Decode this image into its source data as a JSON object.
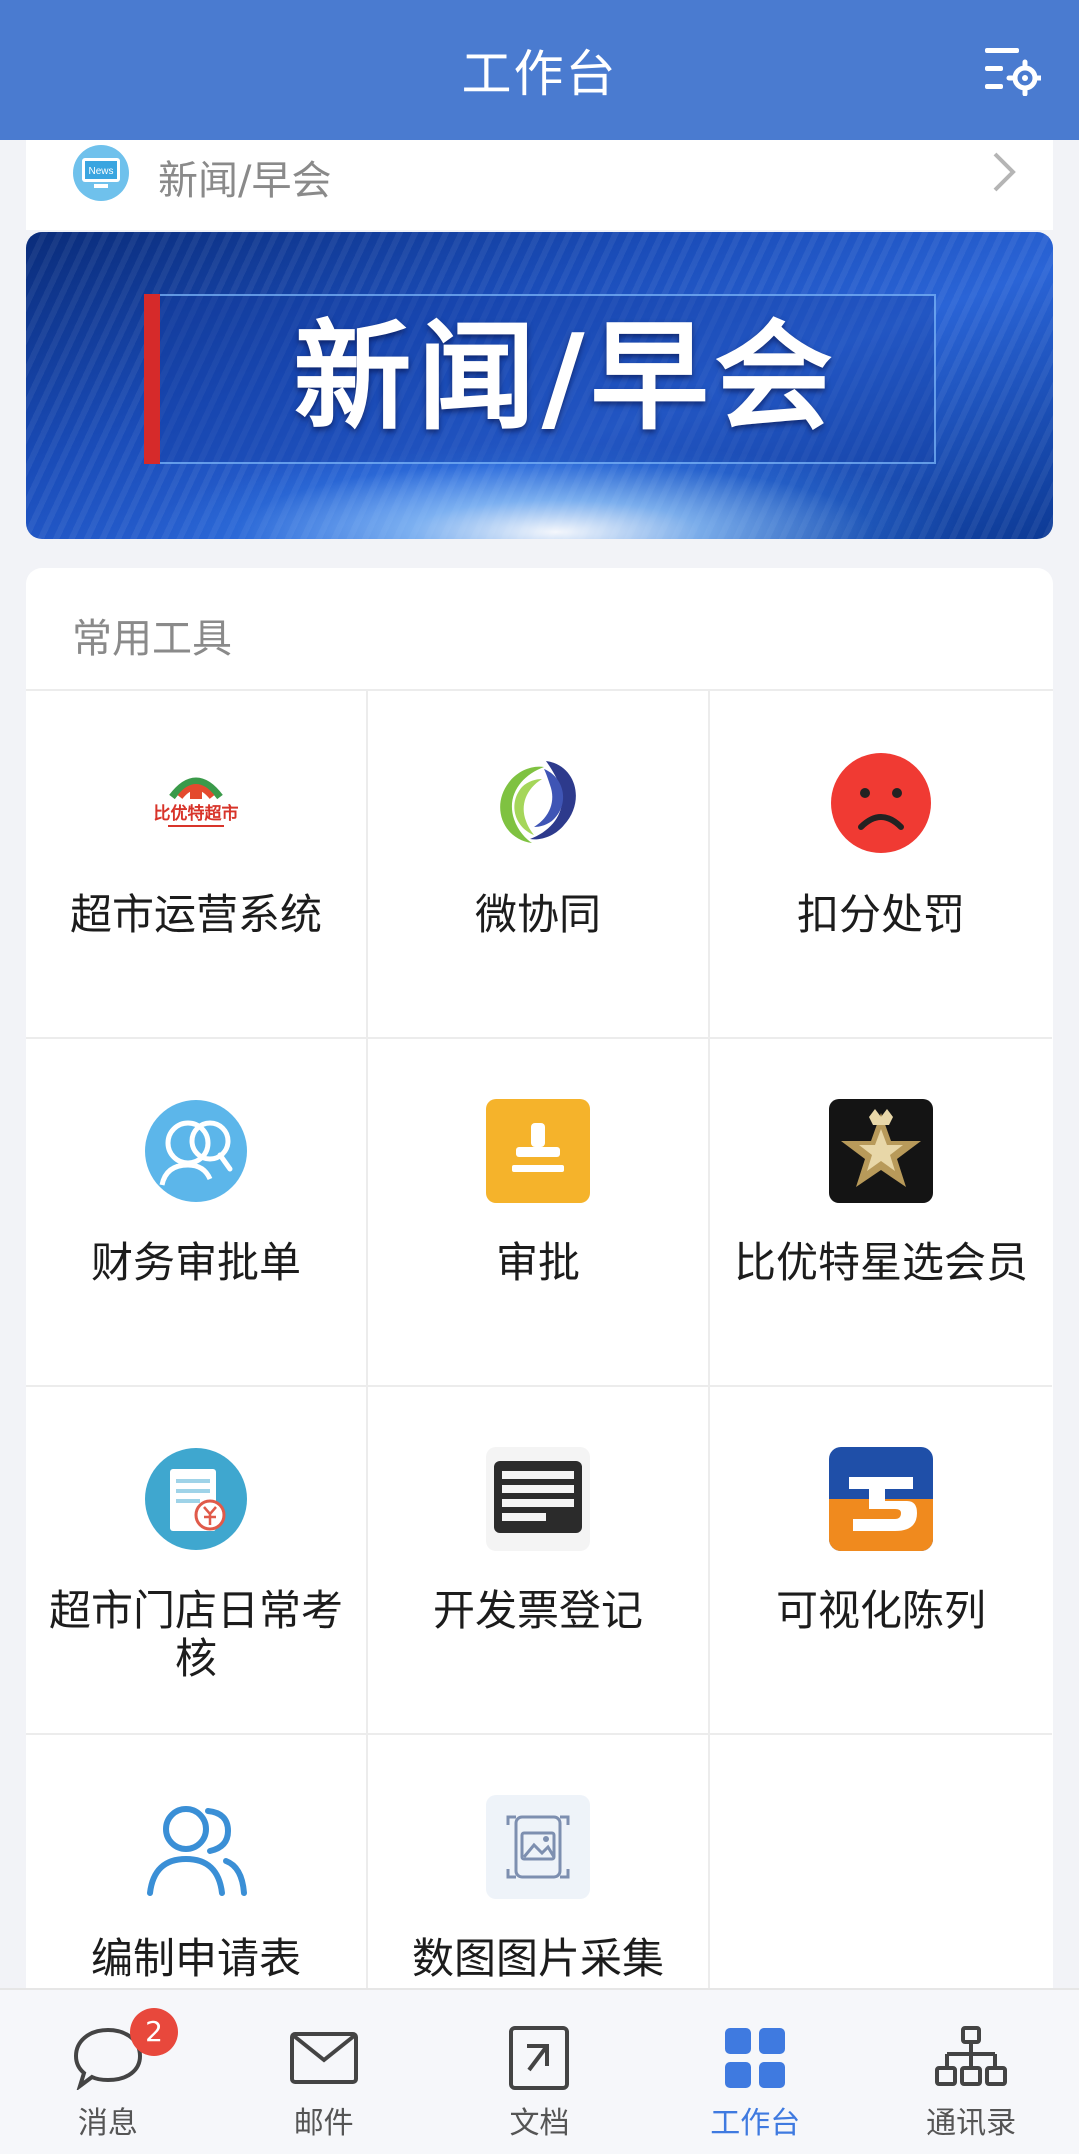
{
  "header": {
    "title": "工作台",
    "settings_icon": "menu-settings-icon"
  },
  "news": {
    "label": "新闻/早会",
    "icon_text": "News"
  },
  "banner": {
    "text": "新闻/早会"
  },
  "tools": {
    "title": "常用工具",
    "items": [
      {
        "label": "超市运营系统",
        "icon": "supermarket-logo-icon",
        "logo_text": "比优特超市"
      },
      {
        "label": "微协同",
        "icon": "swirl-logo-icon"
      },
      {
        "label": "扣分处罚",
        "icon": "sad-face-icon"
      },
      {
        "label": "财务审批单",
        "icon": "people-speech-icon"
      },
      {
        "label": "审批",
        "icon": "stamp-icon"
      },
      {
        "label": "比优特星选会员",
        "icon": "star-member-icon"
      },
      {
        "label": "超市门店日常考核",
        "icon": "receipt-yuan-icon"
      },
      {
        "label": "开发票登记",
        "icon": "invoice-list-icon"
      },
      {
        "label": "可视化陈列",
        "icon": "visual-display-logo-icon"
      },
      {
        "label": "编制申请表",
        "icon": "users-icon"
      },
      {
        "label": "数图图片采集",
        "icon": "image-capture-icon"
      }
    ]
  },
  "tabbar": {
    "items": [
      {
        "label": "消息",
        "icon": "chat-bubble-icon",
        "badge": "2",
        "active": false
      },
      {
        "label": "邮件",
        "icon": "envelope-icon",
        "active": false
      },
      {
        "label": "文档",
        "icon": "document-icon",
        "active": false
      },
      {
        "label": "工作台",
        "icon": "grid-icon",
        "active": true
      },
      {
        "label": "通讯录",
        "icon": "org-chart-icon",
        "active": false
      }
    ]
  },
  "colors": {
    "header": "#4a7bd0",
    "active_tab": "#3f7ae0",
    "badge": "#e8483c"
  }
}
